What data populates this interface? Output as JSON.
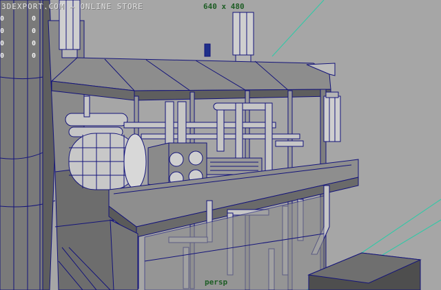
{
  "viewport": {
    "watermark": "3DEXPORT.COM – ONLINE STORE",
    "resolution_gate": "640 x 480",
    "camera_label": "persp"
  },
  "hud_digits": {
    "left_column": [
      "0",
      "0",
      "0",
      "0"
    ],
    "right_column": [
      "0",
      "0",
      "0",
      "0"
    ]
  },
  "colors": {
    "background": "#a6a6a6",
    "wireframe": "#13137a",
    "accent_line": "#37c7a6",
    "hud_label": "#1d5d24"
  }
}
